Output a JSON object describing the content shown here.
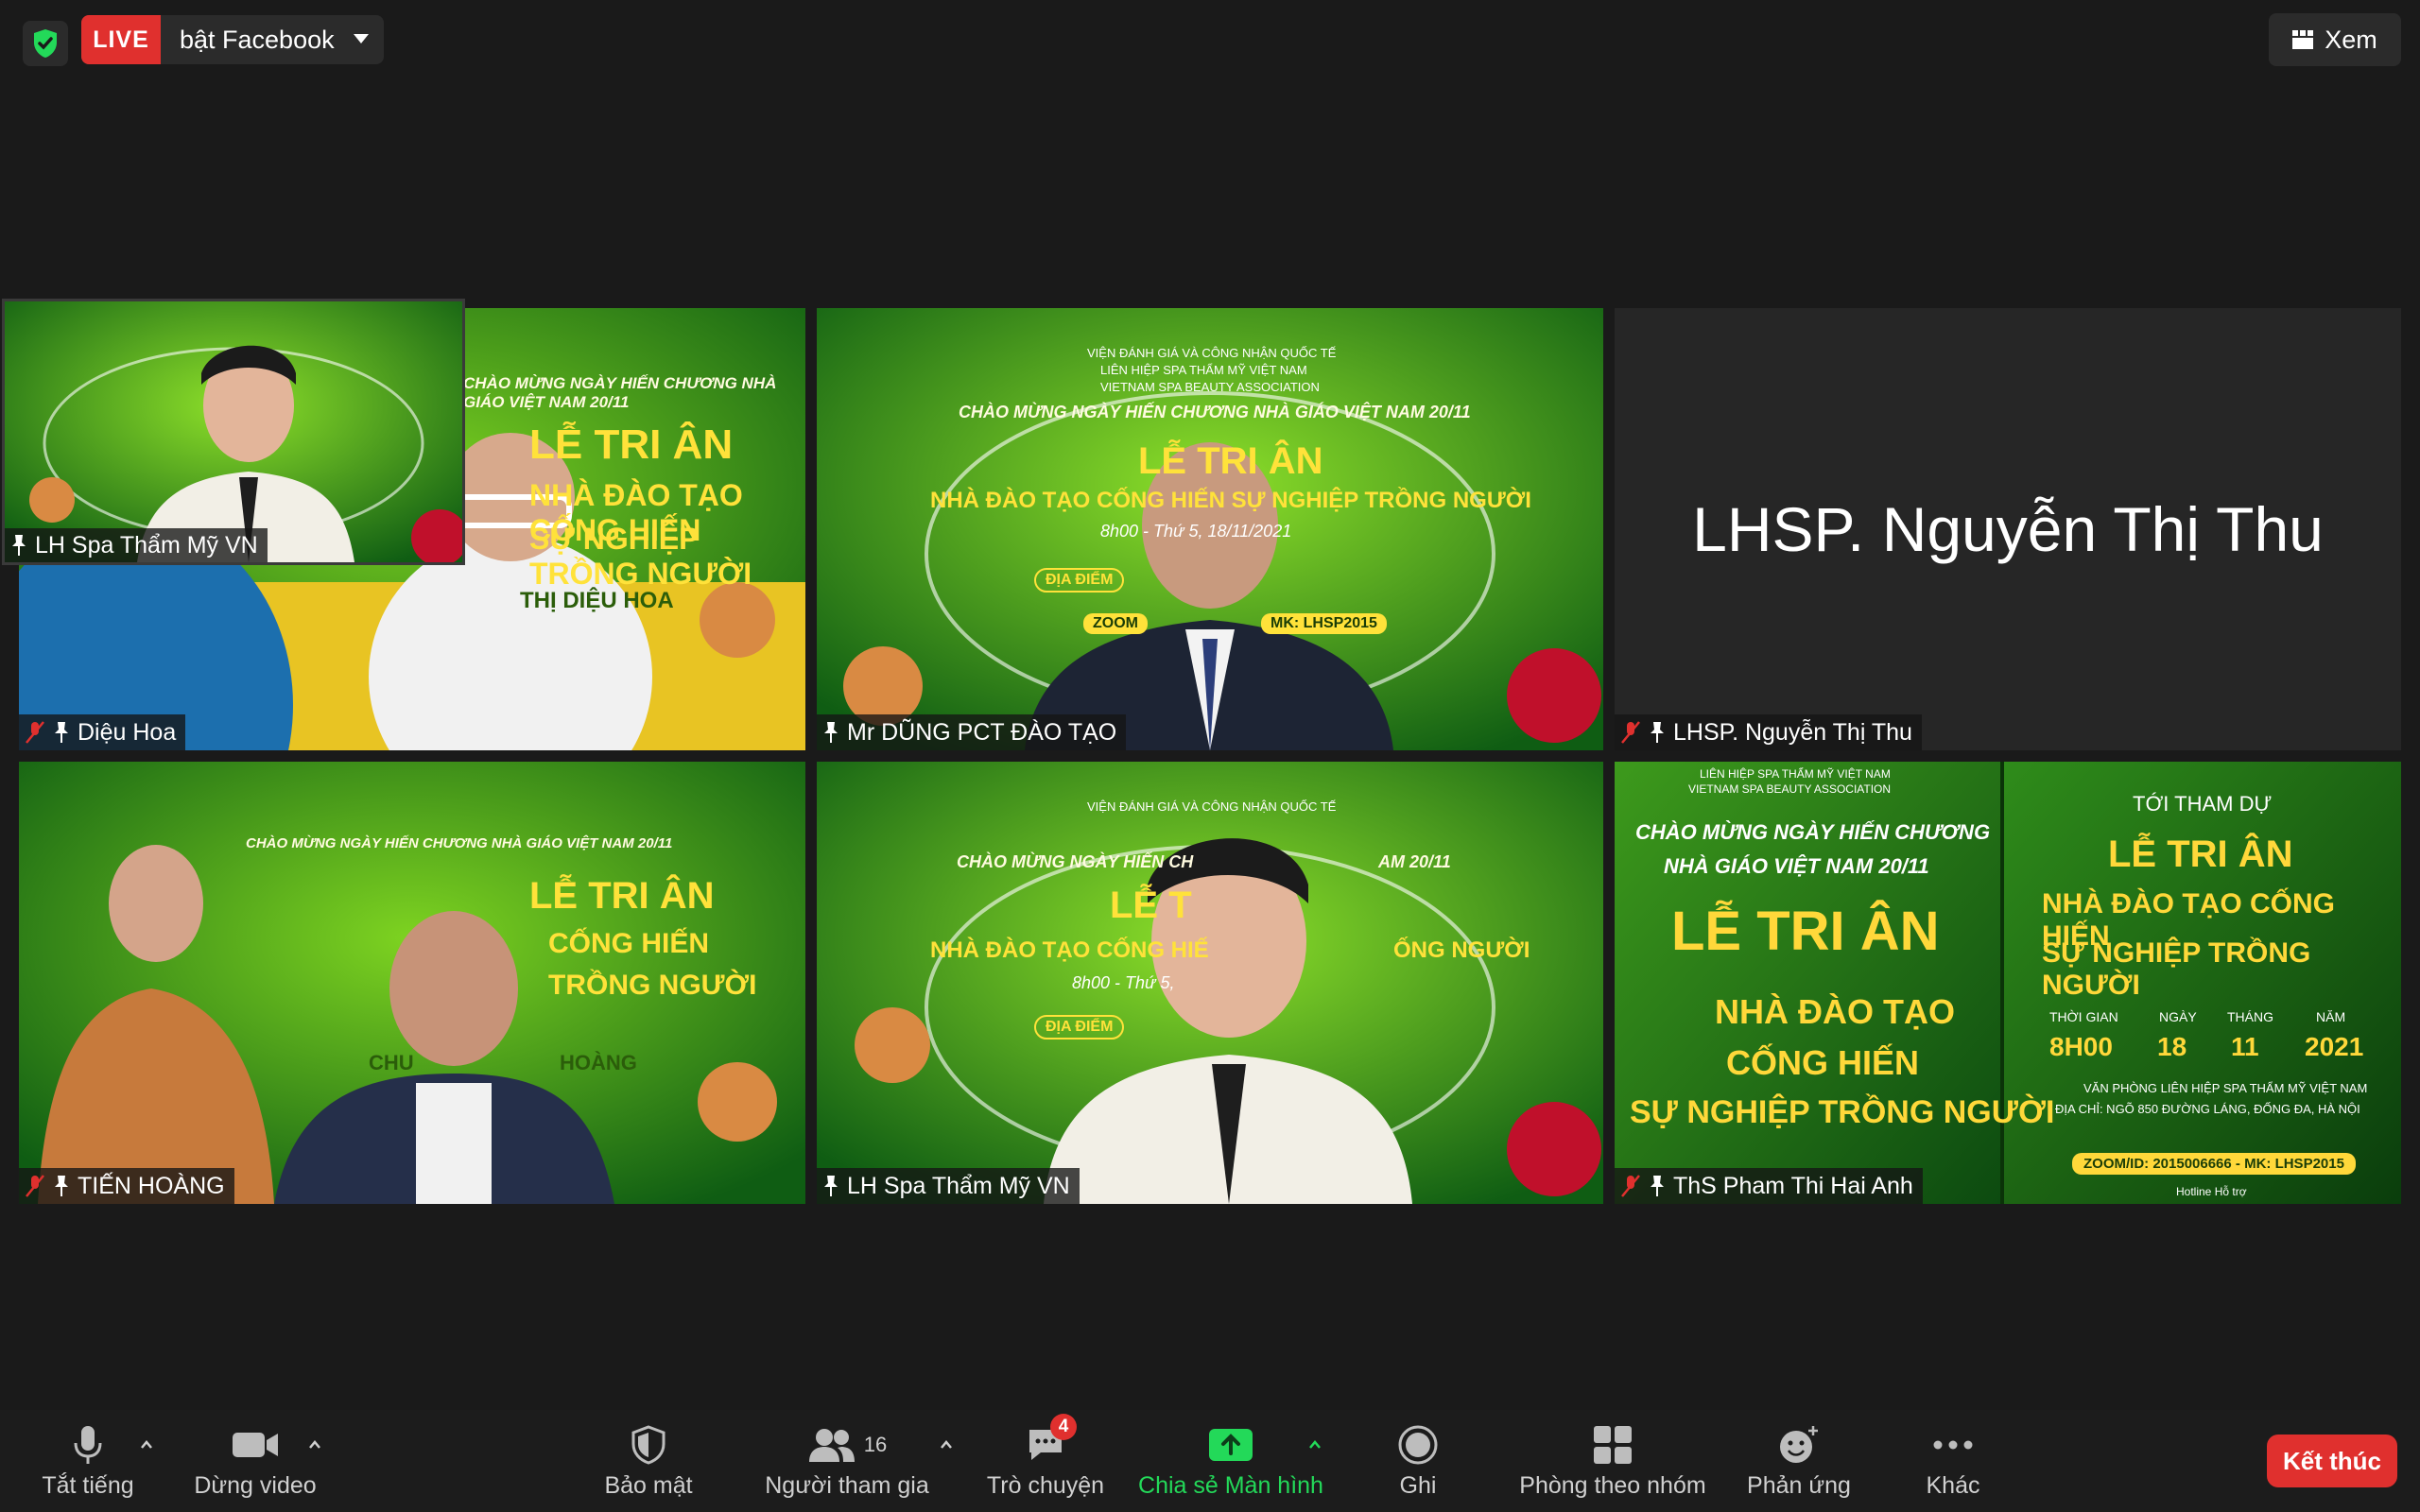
{
  "topbar": {
    "live_label": "LIVE",
    "live_destination": "bật Facebook",
    "view_label": "Xem"
  },
  "self_view": {
    "name": "LH Spa Thẩm Mỹ VN"
  },
  "tiles": [
    {
      "name": "Diệu Hoa",
      "muted": true,
      "banner": [
        "CHÀO MỪNG NGÀY HIẾN CHƯƠNG NHÀ GIÁO VIỆT NAM 20/11",
        "LỄ TRI ÂN",
        "NHÀ ĐÀO TẠO CỐNG HIẾN",
        "SỰ NGHIỆP TRỒNG NGƯỜI",
        "THỊ DIỆU HOA"
      ]
    },
    {
      "name": "Mr DŨNG PCT ĐÀO TẠO",
      "muted": false,
      "banner": [
        "VIỆN ĐÁNH GIÁ VÀ CÔNG NHẬN QUỐC TẾ",
        "LIÊN HIỆP SPA THẨM MỸ VIỆT NAM",
        "VIETNAM SPA BEAUTY ASSOCIATION",
        "CHÀO MỪNG NGÀY HIẾN CHƯƠNG NHÀ GIÁO VIỆT NAM 20/11",
        "LỄ TRI ÂN",
        "NHÀ ĐÀO TẠO CỐNG HIẾN SỰ NGHIỆP TRỒNG NGƯỜI",
        "8h00 - Thứ 5, 18/11/2021",
        "ĐỊA ĐIỂM",
        "ZOOM",
        "MK: LHSP2015"
      ]
    },
    {
      "name": "LHSP.  Nguyễn Thị Thu",
      "muted": true,
      "display_name": "LHSP.  Nguyễn Thị Thu"
    },
    {
      "name": "TIẾN HOÀNG",
      "muted": true,
      "banner": [
        "CHÀO MỪNG NGÀY HIẾN CHƯƠNG NHÀ GIÁO VIỆT NAM 20/11",
        "LỄ TRI ÂN",
        "CỐNG HIẾN",
        "TRỒNG NGƯỜI",
        "CHU",
        "HOÀNG"
      ]
    },
    {
      "name": "LH Spa Thẩm Mỹ VN",
      "muted": false,
      "banner": [
        "VIỆN ĐÁNH GIÁ VÀ CÔNG NHẬN QUỐC TẾ",
        "CHÀO MỪNG NGÀY HIẾN CH",
        "AM 20/11",
        "LỄ T",
        "NHÀ ĐÀO TẠO CỐNG HIẾ",
        "ỐNG NGƯỜI",
        "8h00 - Thứ 5,",
        "ĐỊA ĐIỂM"
      ]
    },
    {
      "name": "ThS Pham Thi Hai Anh",
      "muted": true,
      "banner_left": [
        "LIÊN HIỆP SPA THẨM MỸ VIỆT NAM",
        "VIETNAM SPA BEAUTY ASSOCIATION",
        "CHÀO MỪNG NGÀY HIẾN CHƯƠNG",
        "NHÀ GIÁO VIỆT NAM 20/11",
        "LỄ TRI ÂN",
        "NHÀ ĐÀO TẠO",
        "CỐNG HIẾN",
        "SỰ NGHIỆP TRỒNG NGƯỜI"
      ],
      "banner_right": [
        "TỚI THAM DỰ",
        "LỄ TRI ÂN",
        "NHÀ ĐÀO TẠO CỐNG HIẾN",
        "SỰ NGHIỆP TRỒNG NGƯỜI",
        "THỜI GIAN",
        "NGÀY",
        "THÁNG",
        "NĂM",
        "8H00",
        "18",
        "11",
        "2021",
        "VĂN PHÒNG LIÊN HIỆP SPA THẨM MỸ VIỆT NAM",
        "ĐỊA CHỈ: NGÕ 850 ĐƯỜNG LÁNG, ĐỐNG ĐA, HÀ NỘI",
        "ZOOM/ID: 2015006666 - MK: LHSP2015",
        "Hotline Hỗ trợ"
      ]
    }
  ],
  "toolbar": {
    "mute": "Tắt tiếng",
    "video": "Dừng video",
    "security": "Bảo mật",
    "participants": "Người tham gia",
    "participants_count": "16",
    "chat": "Trò chuyện",
    "chat_badge": "4",
    "share": "Chia sẻ Màn hình",
    "record": "Ghi",
    "breakout": "Phòng theo nhóm",
    "reactions": "Phản ứng",
    "more": "Khác",
    "end": "Kết thúc"
  },
  "colors": {
    "accent_green": "#23d959",
    "end_red": "#e0302e",
    "live_red": "#e0302e",
    "tile_green": "#1f7a1a"
  }
}
